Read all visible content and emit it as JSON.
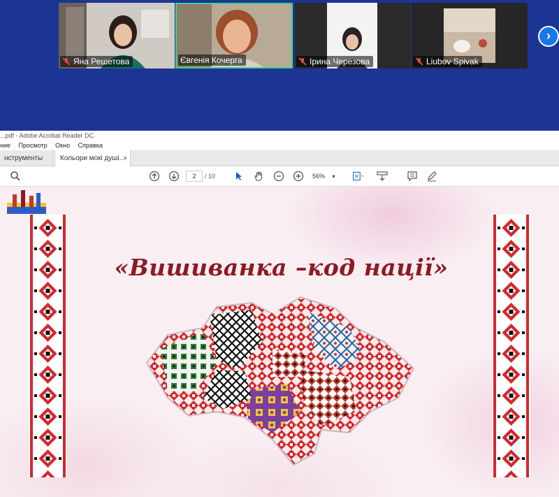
{
  "meeting": {
    "participants": [
      {
        "name": "Яна Решетова",
        "muted": true
      },
      {
        "name": "Євгенія Кочерга",
        "muted": false,
        "active_speaker": true
      },
      {
        "name": "Ірина Черезова",
        "muted": true
      },
      {
        "name": "Liubov Spivak",
        "muted": true
      }
    ],
    "next_icon": "chevron-right-icon",
    "accent_color": "#1c3494",
    "speaker_highlight": "#3ad97a"
  },
  "acrobat": {
    "title": "...pdf - Adobe Acrobat Reader DC",
    "menu": [
      "ние",
      "Просмотр",
      "Окно",
      "Справка"
    ],
    "tabs": {
      "tools": "нструменты",
      "document": "Кольори мокі душі...",
      "close": "×"
    },
    "toolbar": {
      "page_current": "2",
      "page_total": "/ 10",
      "zoom": "56%",
      "icons": [
        "search-icon",
        "page-up-icon",
        "page-down-icon",
        "select-arrow-icon",
        "hand-icon",
        "zoom-out-icon",
        "zoom-in-icon",
        "fit-page-icon",
        "scroll-mode-icon",
        "comment-icon",
        "pen-icon"
      ]
    }
  },
  "slide": {
    "title": "«Вишиванка –код нації»",
    "colors": {
      "title": "#8e1a22",
      "ornament_red": "#d6262c",
      "ornament_black": "#111111"
    }
  }
}
